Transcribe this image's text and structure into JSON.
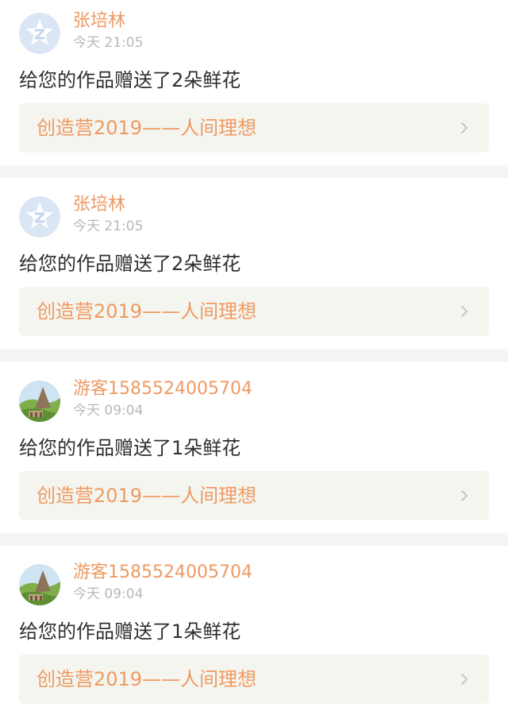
{
  "feed": {
    "items": [
      {
        "username": "张培林",
        "time": "今天 21:05",
        "message": "给您的作品赠送了2朵鲜花",
        "work_title": "创造营2019——人间理想",
        "avatar_icon": "qq-star-default-avatar"
      },
      {
        "username": "张培林",
        "time": "今天 21:05",
        "message": "给您的作品赠送了2朵鲜花",
        "work_title": "创造营2019——人间理想",
        "avatar_icon": "qq-star-default-avatar"
      },
      {
        "username": "游客1585524005704",
        "time": "今天 09:04",
        "message": "给您的作品赠送了1朵鲜花",
        "work_title": "创造营2019——人间理想",
        "avatar_icon": "landscape-photo-avatar"
      },
      {
        "username": "游客1585524005704",
        "time": "今天 09:04",
        "message": "给您的作品赠送了1朵鲜花",
        "work_title": "创造营2019——人间理想",
        "avatar_icon": "landscape-photo-avatar"
      }
    ],
    "colors": {
      "accent": "#ee9a63",
      "timestamp": "#b8b8b8",
      "message": "#2f2f2f",
      "link_background": "#f5f5ef",
      "separator": "#f5f5f5"
    }
  }
}
